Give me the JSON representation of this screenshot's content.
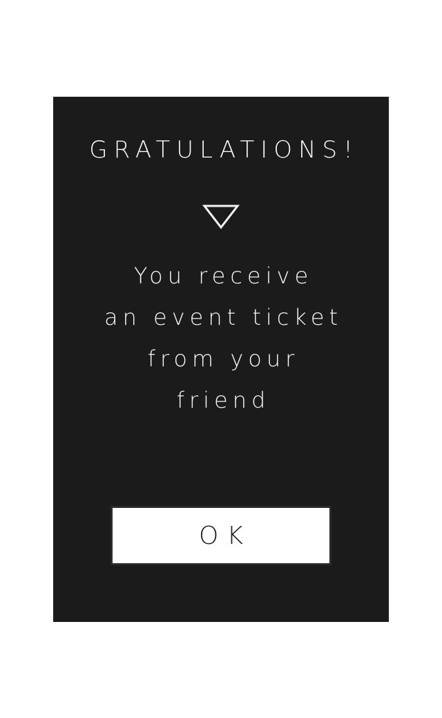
{
  "dialog": {
    "title": "GRATULATIONS!",
    "icon": "triangle-down-icon",
    "message_lines": [
      "You receive",
      "an event ticket",
      "from your",
      "friend"
    ],
    "ok_label": "OK"
  },
  "colors": {
    "page_background": "#ffffff",
    "dialog_background": "#1b1b1b",
    "text": "#f5f5f5",
    "button_background": "#ffffff",
    "button_text": "#1b1b1b"
  }
}
